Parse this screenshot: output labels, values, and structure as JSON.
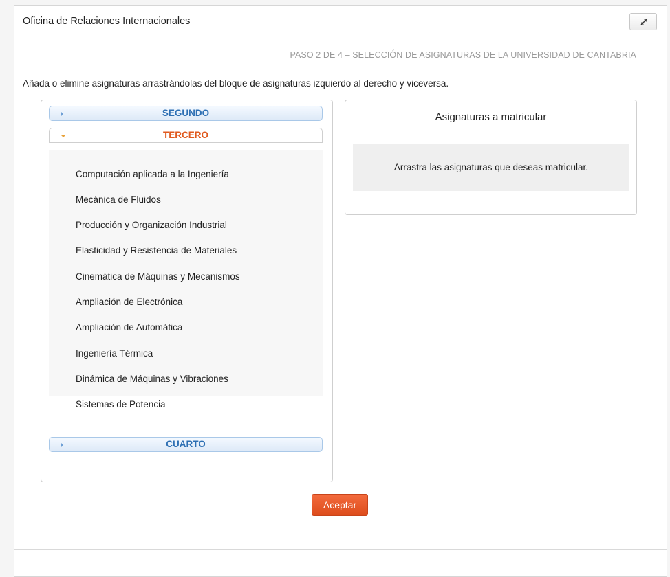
{
  "panel": {
    "title": "Oficina de Relaciones Internacionales"
  },
  "step": {
    "text": "PASO 2 DE 4 – SELECCIÓN DE ASIGNATURAS DE LA UNIVERSIDAD DE CANTABRIA"
  },
  "instructions": "Añada o elimine asignaturas arrastrándolas del bloque de asignaturas izquierdo al derecho y viceversa.",
  "accordion": {
    "sections": [
      {
        "label": "SEGUNDO",
        "expanded": false
      },
      {
        "label": "TERCERO",
        "expanded": true
      },
      {
        "label": "CUARTO",
        "expanded": false
      }
    ],
    "subjects": [
      "Computación aplicada a la Ingeniería",
      "Mecánica de Fluidos",
      "Producción y Organización Industrial",
      "Elasticidad y Resistencia de Materiales",
      "Cinemática de Máquinas y Mecanismos",
      "Ampliación de Electrónica",
      "Ampliación de Automática",
      "Ingeniería Térmica",
      "Dinámica de Máquinas y Vibraciones",
      "Sistemas de Potencia"
    ]
  },
  "selected": {
    "title": "Asignaturas a matricular",
    "placeholder": "Arrastra las asignaturas que deseas matricular."
  },
  "actions": {
    "accept_label": "Aceptar"
  },
  "icons": {
    "expand": "expand-icon",
    "collapsed_arrow": "chevron-right-icon",
    "expanded_arrow": "chevron-down-icon"
  },
  "colors": {
    "accent_blue": "#2d6fb3",
    "accent_orange": "#e05a1f",
    "button": "#e8562a"
  }
}
